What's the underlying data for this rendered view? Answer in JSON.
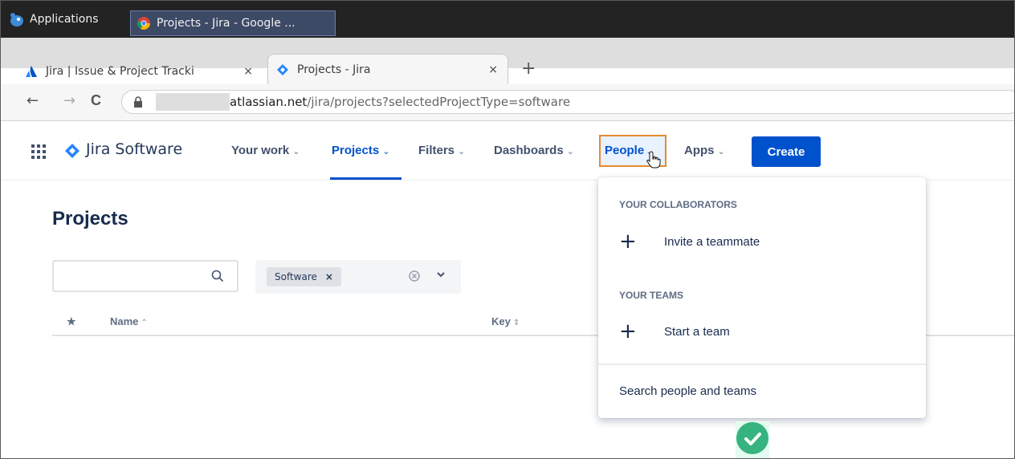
{
  "panel": {
    "applications_label": "Applications",
    "task_title": "Projects - Jira - Google ..."
  },
  "browser": {
    "tabs": [
      {
        "title": "Jira | Issue & Project Tracki",
        "close": "×"
      },
      {
        "title": "Projects - Jira",
        "close": "×"
      }
    ],
    "new_tab": "+",
    "back": "←",
    "forward": "→",
    "reload": "C",
    "url_host": "atlassian.net",
    "url_path": "/jira/projects?selectedProjectType=software"
  },
  "jira_nav": {
    "product": "Jira Software",
    "items": [
      {
        "label": "Your work",
        "chevron": "⌄"
      },
      {
        "label": "Projects",
        "chevron": "⌄"
      },
      {
        "label": "Filters",
        "chevron": "⌄"
      },
      {
        "label": "Dashboards",
        "chevron": "⌄"
      },
      {
        "label": "People",
        "chevron": "⌄"
      },
      {
        "label": "Apps",
        "chevron": "⌄"
      }
    ],
    "create_label": "Create"
  },
  "page": {
    "title": "Projects",
    "search_placeholder": "",
    "filter_chip": "Software",
    "filter_chip_remove": "×",
    "columns": [
      {
        "label": "★"
      },
      {
        "label": "Name",
        "sort": "⌃"
      },
      {
        "label": "Key",
        "sort": "⇕"
      }
    ]
  },
  "people_menu": {
    "section_collaborators": "YOUR COLLABORATORS",
    "invite_label": "Invite a teammate",
    "section_teams": "YOUR TEAMS",
    "start_team_label": "Start a team",
    "plus": "+",
    "search_label": "Search people and teams"
  },
  "colors": {
    "accent": "#0052cc",
    "highlight_border": "#e68a2e",
    "success": "#36b37e"
  }
}
